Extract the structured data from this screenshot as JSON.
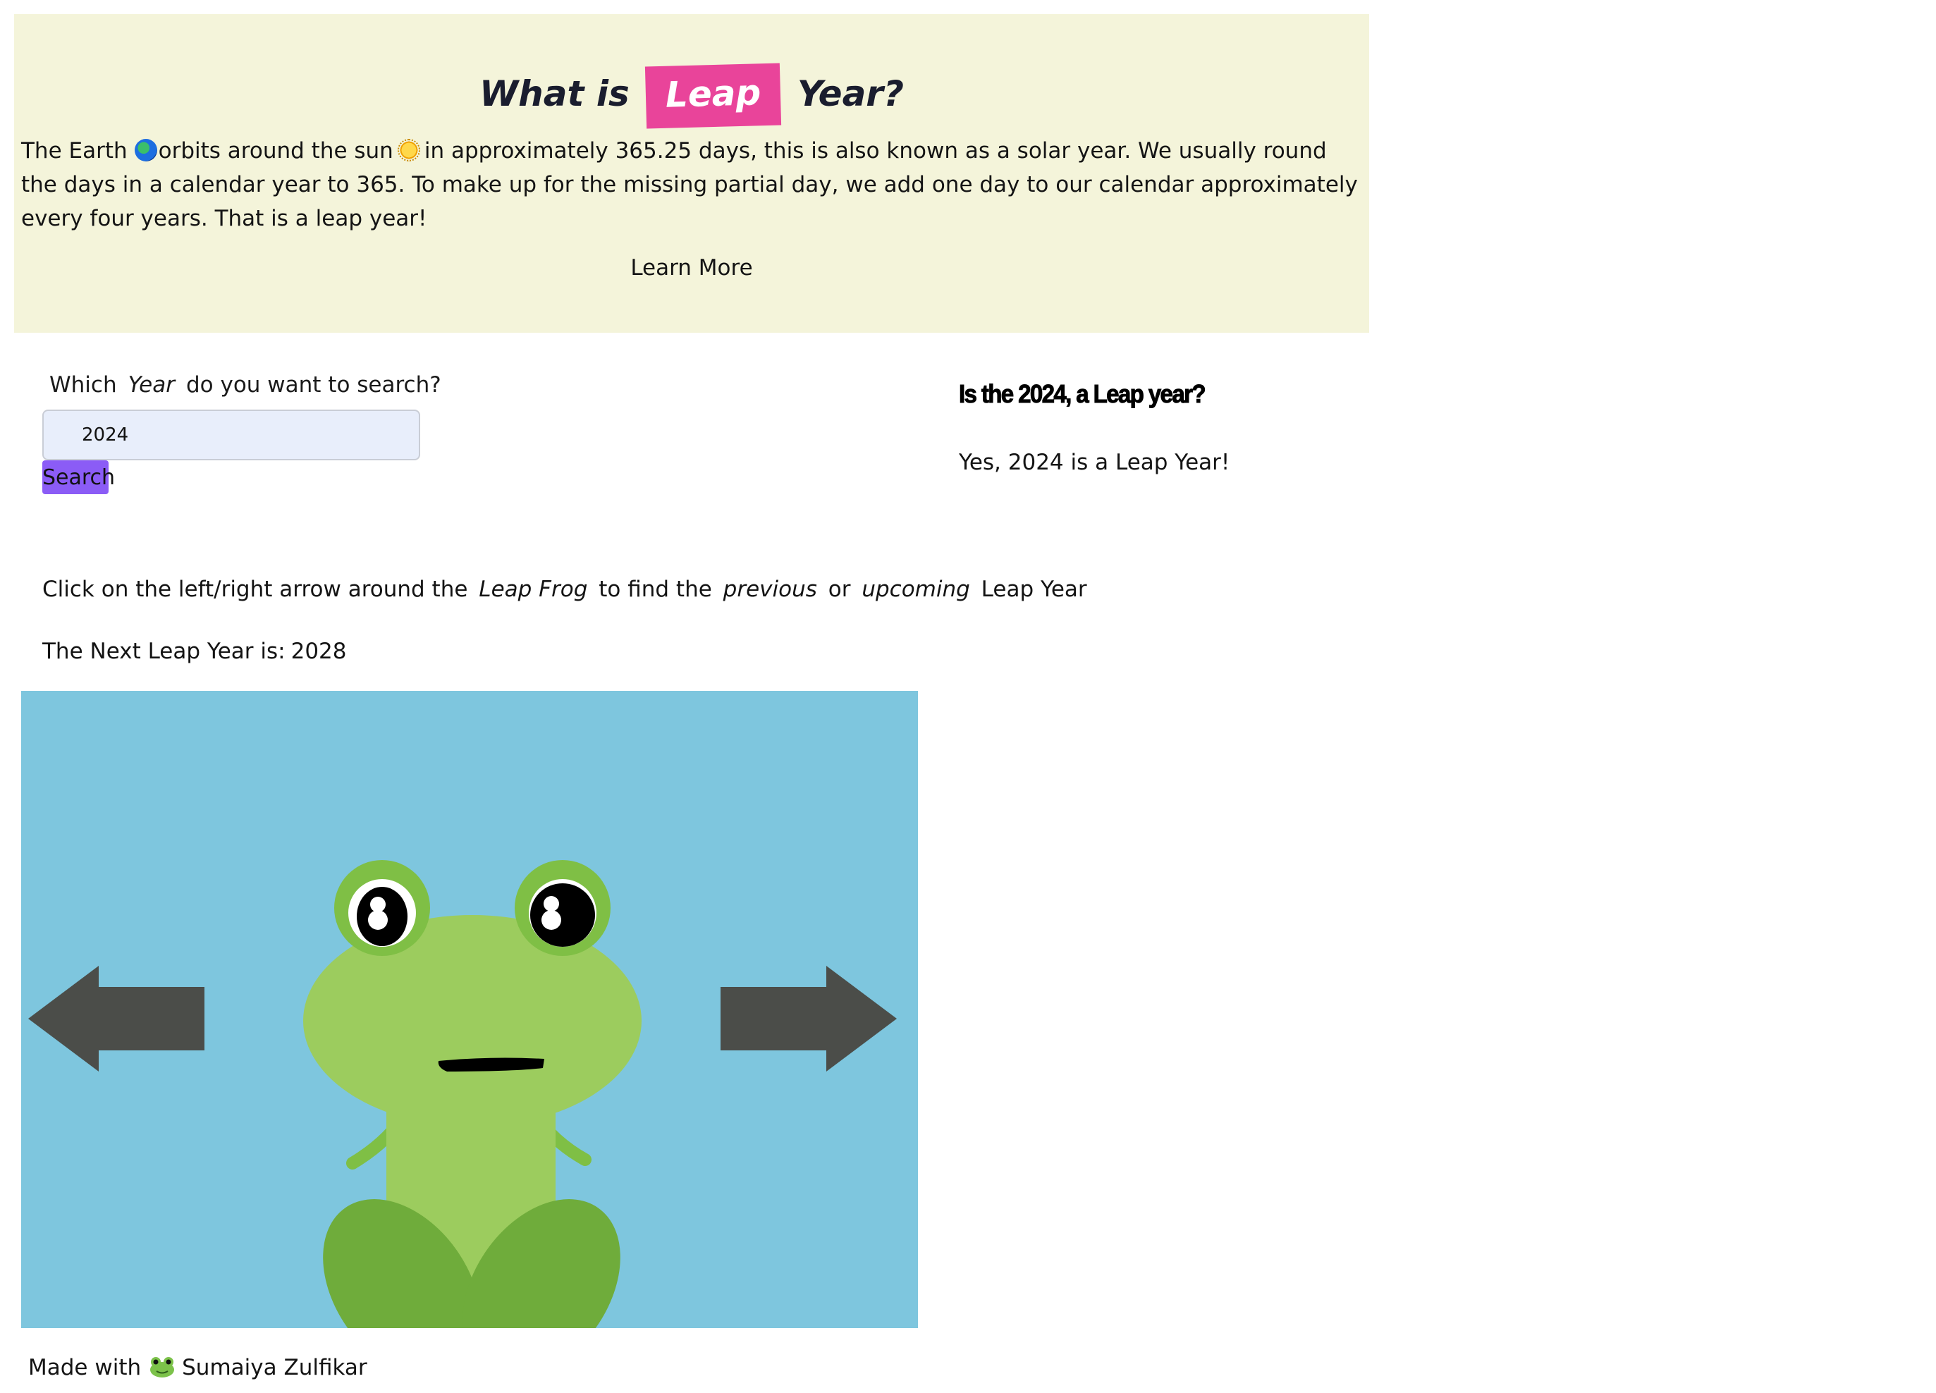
{
  "intro": {
    "title_pre": "What is",
    "title_highlight": "Leap",
    "title_post": "Year?",
    "text_part1": "The Earth",
    "text_part2": "orbits around the sun",
    "text_part3": "in approximately 365.25 days, this is also known as a solar year. We usually round the days in a calendar year to 365. To make up for the missing partial day, we add one day to our calendar approximately every four years. That is a leap year!",
    "learn_more": "Learn More",
    "earth_icon": "earth-globe-icon",
    "sun_icon": "sun-icon"
  },
  "search": {
    "label_pre": "Which",
    "label_em": "Year",
    "label_post": "do you want to search?",
    "value": "2024",
    "button_label": "Search"
  },
  "result": {
    "heading": "Is the 2024, a Leap year?",
    "answer": "Yes, 2024 is a Leap Year!"
  },
  "instructions": {
    "part1": "Click on the left/right arrow around the",
    "em1": "Leap Frog",
    "part2": "to find the",
    "em2": "previous",
    "part3": "or",
    "em3": "upcoming",
    "part4": "Leap Year"
  },
  "next_leap": {
    "label": "The Next Leap Year is:",
    "year": "2028"
  },
  "game": {
    "background_color": "#7ec6de",
    "arrow_color": "#4b4d49",
    "frog_body_color": "#9ccc5e",
    "frog_dark_color": "#6fac3b",
    "left_arrow_icon": "left-arrow-icon",
    "right_arrow_icon": "right-arrow-icon"
  },
  "footer": {
    "made_with": "Made with",
    "icon": "frog-icon",
    "author": "Sumaiya Zulfikar"
  },
  "colors": {
    "intro_bg": "#f4f4da",
    "leap_badge": "#e9449a",
    "search_button": "#8b5cf6",
    "input_bg": "#e8eefb"
  }
}
